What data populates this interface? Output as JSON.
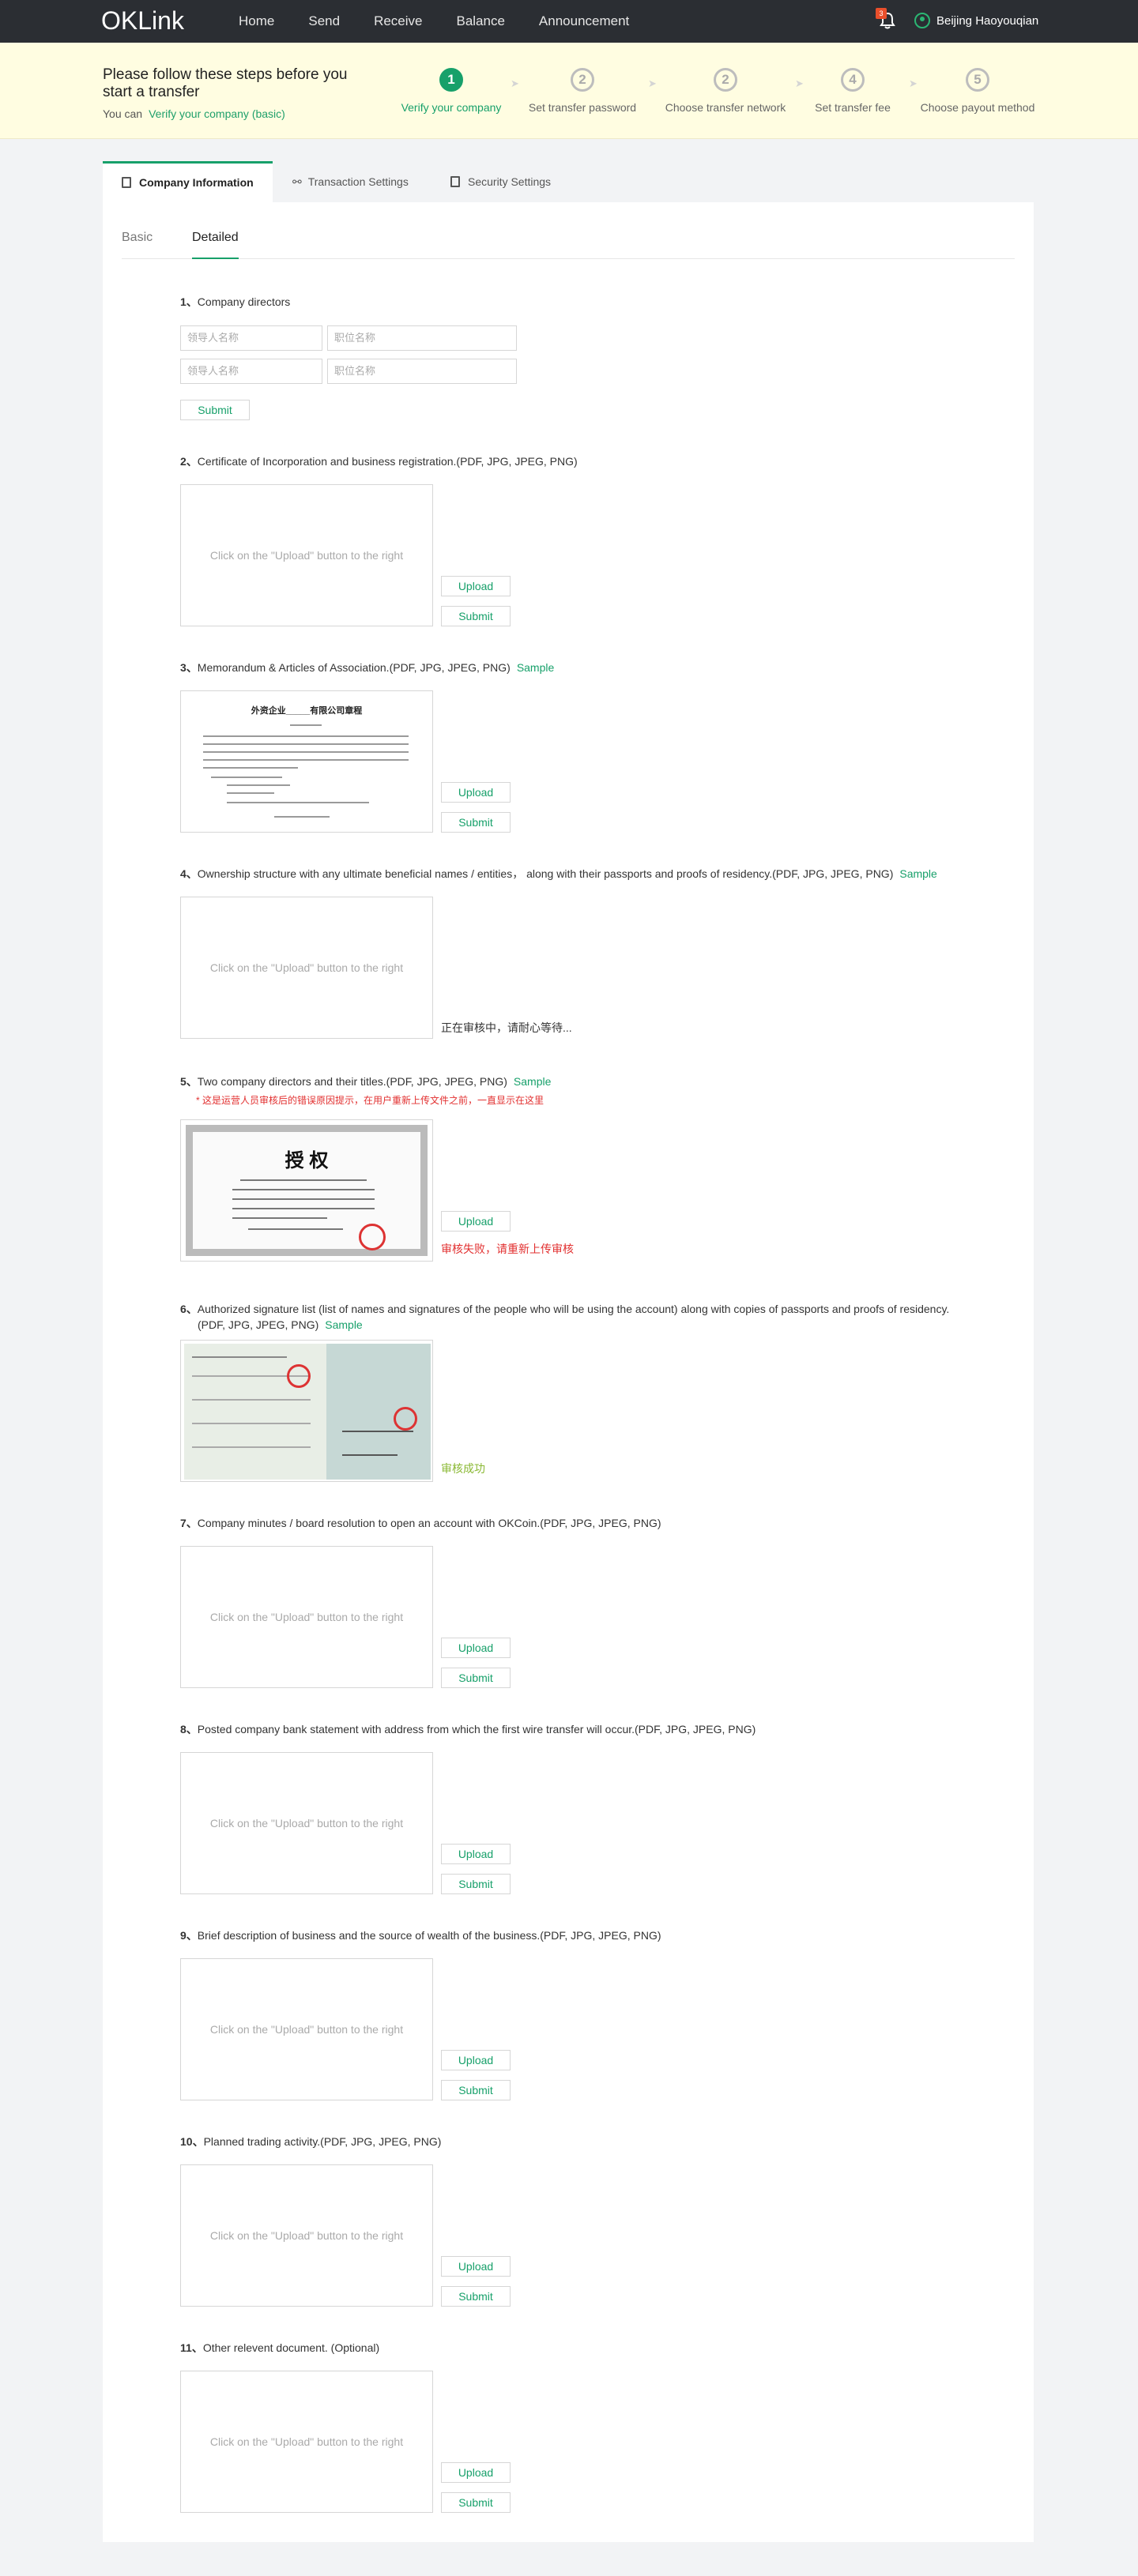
{
  "header": {
    "logo": "OKLink",
    "nav": [
      "Home",
      "Send",
      "Receive",
      "Balance",
      "Announcement"
    ],
    "notification_count": "3",
    "user_name": "Beijing  Haoyouqian"
  },
  "banner": {
    "title": "Please follow these steps before you start a transfer",
    "you_can": "You can",
    "verify_link": "Verify your company (basic)",
    "steps": [
      {
        "num": "1",
        "label": "Verify your company"
      },
      {
        "num": "2",
        "label": "Set transfer password"
      },
      {
        "num": "2",
        "label": "Choose transfer network"
      },
      {
        "num": "4",
        "label": "Set transfer fee"
      },
      {
        "num": "5",
        "label": "Choose payout method"
      }
    ]
  },
  "tabs": [
    "Company Information",
    "Transaction Settings",
    "Security Settings"
  ],
  "subtabs": [
    "Basic",
    "Detailed"
  ],
  "buttons": {
    "upload": "Upload",
    "submit": "Submit",
    "sample": "Sample"
  },
  "placeholder_box": "Click on the \"Upload\" button to the right",
  "directors": {
    "name_placeholder": "领导人名称",
    "title_placeholder": "职位名称"
  },
  "items": [
    {
      "num": "1、",
      "text": "Company directors"
    },
    {
      "num": "2、",
      "text": "Certificate of Incorporation and business registration.(PDF, JPG, JPEG, PNG)"
    },
    {
      "num": "3、",
      "text": "Memorandum & Articles of Association.(PDF, JPG, JPEG, PNG)"
    },
    {
      "num": "4、",
      "text": "Ownership structure with any ultimate beneficial names / entities，  along with their passports and proofs of residency.(PDF, JPG, JPEG, PNG)"
    },
    {
      "num": "5、",
      "text": "Two company directors and their titles.(PDF, JPG, JPEG, PNG)"
    },
    {
      "num": "6、",
      "text": "Authorized signature list (list of names and signatures of the people who will be using the account) along with copies of passports and proofs of residency.",
      "text2": "(PDF, JPG, JPEG, PNG)"
    },
    {
      "num": "7、",
      "text": "Company minutes / board resolution to open an account with OKCoin.(PDF, JPG, JPEG, PNG)"
    },
    {
      "num": "8、",
      "text": "Posted company bank statement with address from which the first wire transfer will occur.(PDF, JPG, JPEG, PNG)"
    },
    {
      "num": "9、",
      "text": "Brief description of business and the source of wealth of the business.(PDF, JPG, JPEG, PNG)"
    },
    {
      "num": "10、",
      "text": "Planned trading activity.(PDF, JPG, JPEG, PNG)"
    },
    {
      "num": "11、",
      "text": "Other relevent document. (Optional)"
    }
  ],
  "item3_doc": {
    "title": "外资企业_____有限公司章程"
  },
  "item4_status": "正在审核中，请耐心等待...",
  "item5_warning": "* 这是运营人员审核后的错误原因提示，在用户重新上传文件之前，一直显示在这里",
  "item5_doc": {
    "title": "授    权"
  },
  "item5_status": "审核失败，请重新上传审核",
  "item6_status": "审核成功",
  "colors": {
    "accent": "#17a06a",
    "error": "#e23030",
    "success": "#8ab833",
    "banner": "#fffde1",
    "topbar": "#2b2e33"
  }
}
